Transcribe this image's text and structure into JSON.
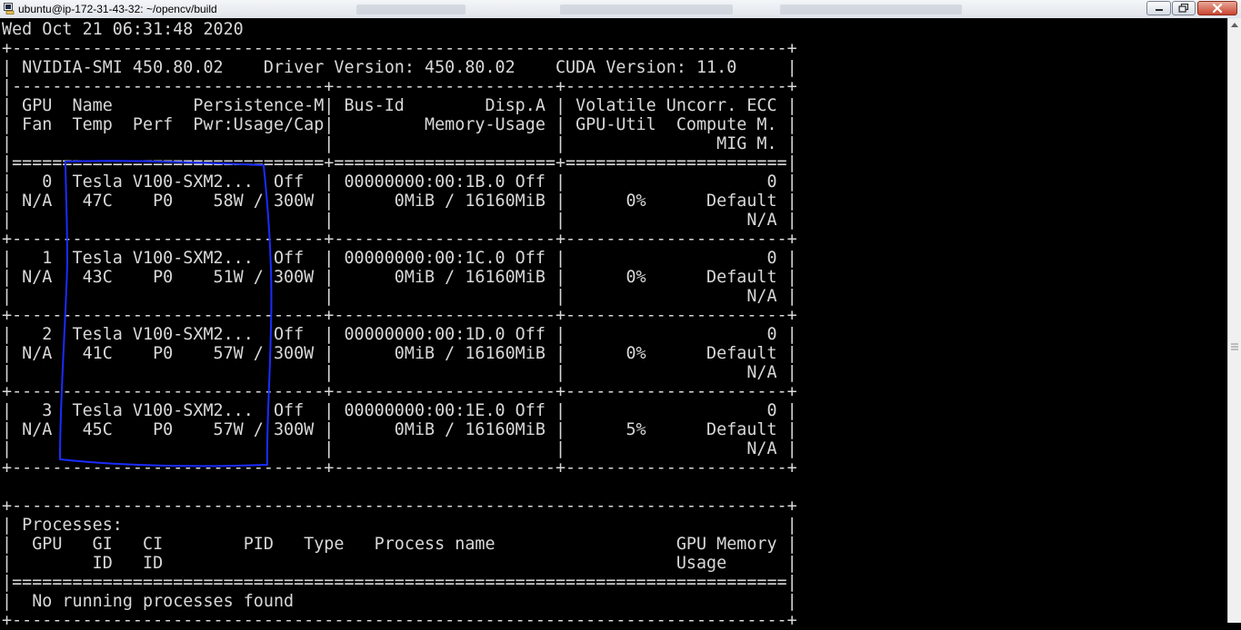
{
  "window": {
    "title": "ubuntu@ip-172-31-43-32: ~/opencv/build"
  },
  "terminal": {
    "lines": [
      "Wed Oct 21 06:31:48 2020",
      "+-----------------------------------------------------------------------------+",
      "| NVIDIA-SMI 450.80.02    Driver Version: 450.80.02    CUDA Version: 11.0     |",
      "|-------------------------------+----------------------+----------------------+",
      "| GPU  Name        Persistence-M| Bus-Id        Disp.A | Volatile Uncorr. ECC |",
      "| Fan  Temp  Perf  Pwr:Usage/Cap|         Memory-Usage | GPU-Util  Compute M. |",
      "|                               |                      |               MIG M. |",
      "|===============================+======================+======================|",
      "|   0  Tesla V100-SXM2...  Off  | 00000000:00:1B.0 Off |                    0 |",
      "| N/A   47C    P0    58W / 300W |      0MiB / 16160MiB |      0%      Default |",
      "|                               |                      |                  N/A |",
      "+-------------------------------+----------------------+----------------------+",
      "|   1  Tesla V100-SXM2...  Off  | 00000000:00:1C.0 Off |                    0 |",
      "| N/A   43C    P0    51W / 300W |      0MiB / 16160MiB |      0%      Default |",
      "|                               |                      |                  N/A |",
      "+-------------------------------+----------------------+----------------------+",
      "|   2  Tesla V100-SXM2...  Off  | 00000000:00:1D.0 Off |                    0 |",
      "| N/A   41C    P0    57W / 300W |      0MiB / 16160MiB |      0%      Default |",
      "|                               |                      |                  N/A |",
      "+-------------------------------+----------------------+----------------------+",
      "|   3  Tesla V100-SXM2...  Off  | 00000000:00:1E.0 Off |                    0 |",
      "| N/A   45C    P0    57W / 300W |      0MiB / 16160MiB |      5%      Default |",
      "|                               |                      |                  N/A |",
      "+-------------------------------+----------------------+----------------------+",
      "",
      "+-----------------------------------------------------------------------------+",
      "| Processes:                                                                  |",
      "|  GPU   GI   CI        PID   Type   Process name                  GPU Memory |",
      "|        ID   ID                                                   Usage      |",
      "|=============================================================================|",
      "|  No running processes found                                                 |",
      "+-----------------------------------------------------------------------------+"
    ]
  },
  "colors": {
    "terminal_bg": "#000000",
    "terminal_fg": "#d8d8d8",
    "highlight_stroke": "#1a2cff"
  },
  "icons": {
    "app": "putty-terminal-icon",
    "minimize": "minimize-icon",
    "maximize": "maximize-icon",
    "close": "close-icon",
    "scroll_up": "arrow-up-icon",
    "scroll_grip": "scroll-grip-icon"
  }
}
